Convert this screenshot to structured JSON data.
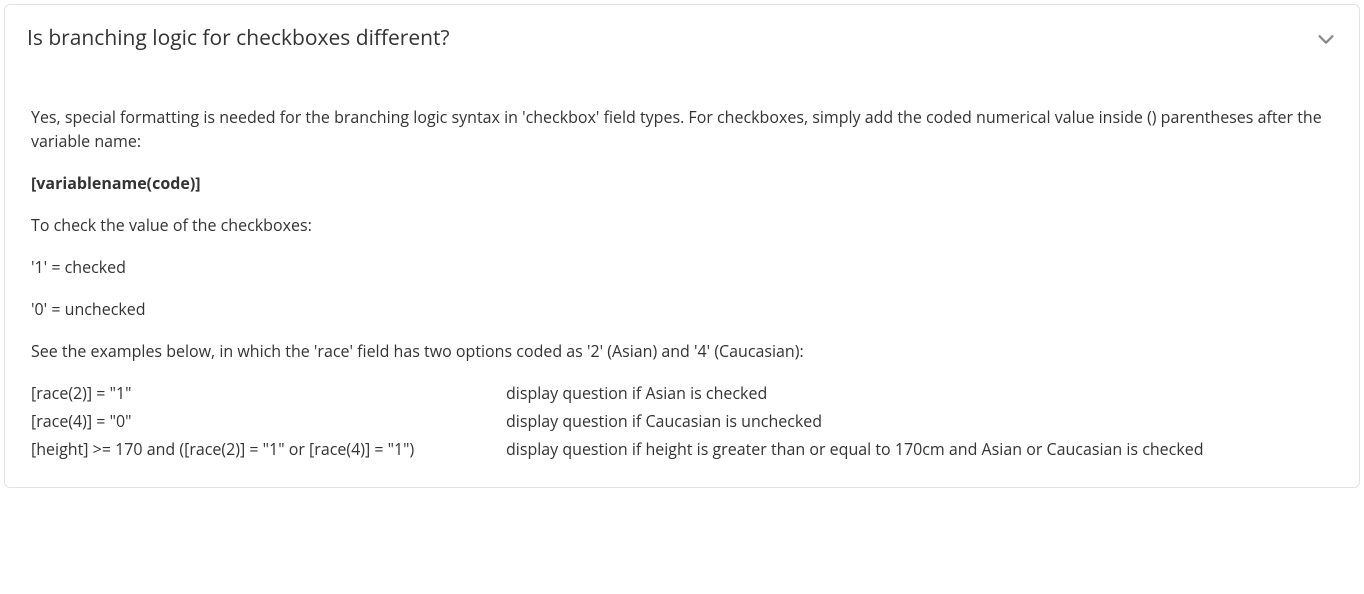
{
  "card": {
    "title": "Is branching logic for checkboxes different?",
    "intro": "Yes, special formatting is needed for the branching logic syntax in 'checkbox' field types. For checkboxes, simply add the coded numerical value inside () parentheses after the variable name:",
    "syntax": "[variablename(code)]",
    "check_intro": "To check the value of the checkboxes:",
    "checked": "'1' = checked",
    "unchecked": "'0' = unchecked",
    "examples_intro": "See the examples below, in which the 'race' field has two options coded as '2' (Asian) and '4' (Caucasian):",
    "examples": [
      {
        "code": "[race(2)] = \"1\"",
        "desc": "display question if Asian is checked"
      },
      {
        "code": "[race(4)] = \"0\"",
        "desc": "display question if Caucasian is unchecked"
      },
      {
        "code": "[height] >= 170 and ([race(2)] = \"1\" or [race(4)] = \"1\")",
        "desc": "display question if height is greater than or equal to 170cm and Asian or Caucasian is checked"
      }
    ]
  }
}
